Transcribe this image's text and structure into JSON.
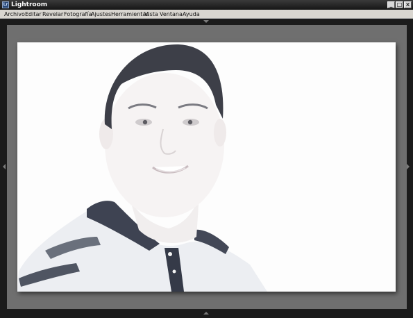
{
  "window": {
    "title": "Lightroom",
    "app_icon_text": "Lr",
    "controls": [
      "_",
      "□",
      "×"
    ]
  },
  "menu": {
    "items": [
      "Archivo",
      "Editar",
      "Revelar",
      "Fotografía",
      "Ajustes",
      "Herramientas",
      "Vista",
      "Ventana",
      "Ayuda"
    ]
  },
  "colors": {
    "canvas_background": "#6f6f6f",
    "frame_background": "#1b1b1b",
    "menubar": "#d9d6d0"
  },
  "photo": {
    "subject": "overexposed portrait of a smiling man in a striped polo shirt"
  }
}
